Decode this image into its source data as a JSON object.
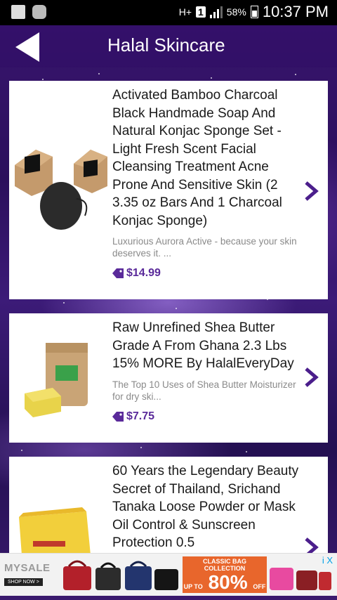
{
  "status_bar": {
    "network": "H+",
    "sim_slot": "1",
    "battery": "58%",
    "time": "10:37 PM"
  },
  "app_bar": {
    "title": "Halal Skincare"
  },
  "products": [
    {
      "title": "Activated Bamboo Charcoal Black Handmade Soap And Natural Konjac Sponge Set - Light Fresh Scent Facial Cleansing Treatment Acne Prone And Sensitive Skin (2 3.35 oz Bars And 1 Charcoal Konjac Sponge)",
      "description": "Luxurious Aurora Active - because your skin deserves it. ...",
      "price": "$14.99"
    },
    {
      "title": "Raw Unrefined Shea Butter Grade A From Ghana 2.3 Lbs 15% MORE By HalalEveryDay",
      "description": "The Top 10 Uses of Shea Butter Moisturizer for dry ski...",
      "price": "$7.75"
    },
    {
      "title": "60 Years the Legendary Beauty Secret of Thailand, Srichand Tanaka Loose Powder or Mask Oil Control & Sunscreen Protection 0.5",
      "description": "",
      "price": ""
    }
  ],
  "ad": {
    "brand": "MYSALE",
    "cta": "SHOP NOW >",
    "headline": "CLASSIC BAG COLLECTION",
    "upto": "UP TO",
    "percent": "80%",
    "off": "OFF",
    "info": "i",
    "close": "X"
  }
}
